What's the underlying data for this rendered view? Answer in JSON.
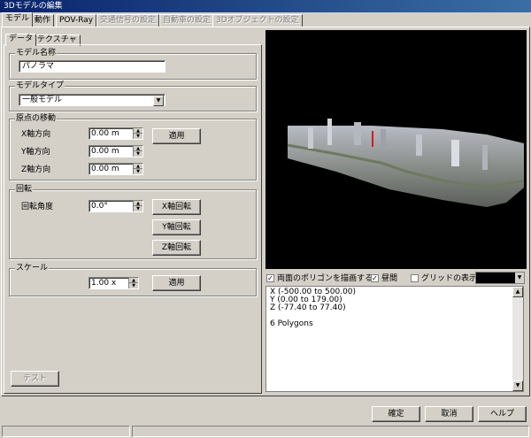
{
  "window": {
    "title": "3Dモデルの編集"
  },
  "tabs": [
    {
      "label": "モデル",
      "active": true,
      "enabled": true
    },
    {
      "label": "動作",
      "active": false,
      "enabled": true
    },
    {
      "label": "POV-Ray",
      "active": false,
      "enabled": true
    },
    {
      "label": "交通信号の設定",
      "active": false,
      "enabled": false
    },
    {
      "label": "自動車の設定",
      "active": false,
      "enabled": false
    },
    {
      "label": "3Dオブジェクトの設定",
      "active": false,
      "enabled": false
    }
  ],
  "subtabs": [
    {
      "label": "データ",
      "active": true
    },
    {
      "label": "テクスチャ",
      "active": false
    }
  ],
  "model_name": {
    "title": "モデル名称",
    "value": "パノラマ"
  },
  "model_type": {
    "title": "モデルタイプ",
    "value": "一般モデル"
  },
  "origin_move": {
    "title": "原点の移動",
    "x_label": "X軸方向",
    "x_value": "0.00 m",
    "y_label": "Y軸方向",
    "y_value": "0.00 m",
    "z_label": "Z軸方向",
    "z_value": "0.00 m",
    "apply_label": "適用"
  },
  "rotation": {
    "title": "回転",
    "angle_label": "回転角度",
    "angle_value": "0.0°",
    "x_rot_label": "X軸回転",
    "y_rot_label": "Y軸回転",
    "z_rot_label": "Z軸回転"
  },
  "scale": {
    "title": "スケール",
    "value": "1.00 x",
    "apply_label": "適用"
  },
  "test_button": "テスト",
  "view_options": {
    "double_sided": {
      "label": "両面のポリゴンを描画する",
      "checked": true
    },
    "daytime": {
      "label": "昼間",
      "checked": true
    },
    "grid": {
      "label": "グリッドの表示",
      "checked": false
    },
    "color": "#000000"
  },
  "info": {
    "x_range": "X (-500.00 to 500.00)",
    "y_range": "Y (0.00 to 179.00)",
    "z_range": "Z (-77.40 to 77.40)",
    "polygons": "6 Polygons"
  },
  "footer": {
    "ok": "確定",
    "cancel": "取消",
    "help": "ヘルプ"
  }
}
